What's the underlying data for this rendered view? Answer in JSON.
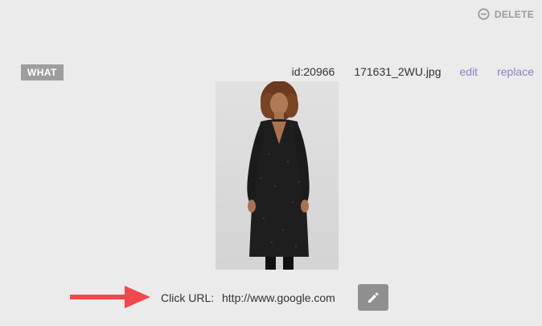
{
  "header": {
    "delete_label": "DELETE",
    "delete_icon": "minus-circle-icon"
  },
  "item": {
    "badge": "WHAT",
    "id_text": "id:20966",
    "filename": "171631_2WU.jpg",
    "edit_label": "edit",
    "replace_label": "replace",
    "image_icon": "product-photo-dress-model"
  },
  "click_url": {
    "label": "Click URL:",
    "value": "http://www.google.com",
    "edit_icon": "pencil-icon",
    "arrow_icon": "arrow-right-icon"
  },
  "colors": {
    "background": "#ebebeb",
    "link": "#8a82c4",
    "badge": "#9e9e9e",
    "arrow": "#f2474d",
    "button": "#8f8f8f"
  }
}
